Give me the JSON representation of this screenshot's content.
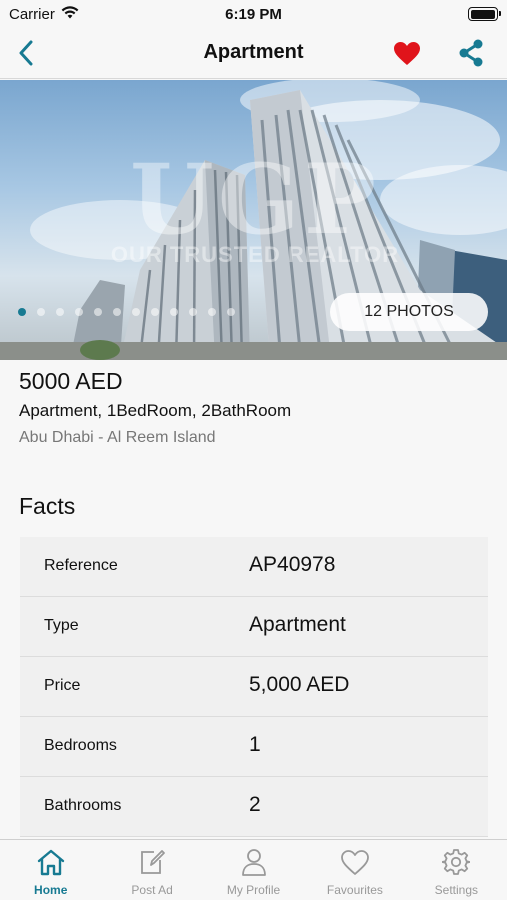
{
  "status_bar": {
    "carrier": "Carrier",
    "time": "6:19 PM",
    "battery_level": 1.0
  },
  "nav": {
    "title": "Apartment",
    "icons": [
      "back-chevron-icon",
      "heart-icon",
      "share-icon"
    ],
    "favourite_active": true
  },
  "gallery": {
    "photos_label": "12 PHOTOS",
    "watermark": {
      "mark": "UGP",
      "tagline": "OUR TRUSTED REALTOR"
    },
    "dot_count": 12,
    "active_index": 0
  },
  "listing": {
    "price": "5000 AED",
    "subtitle": "Apartment, 1BedRoom, 2BathRoom",
    "location": "Abu Dhabi - Al Reem Island"
  },
  "facts": {
    "title": "Facts",
    "rows": [
      {
        "label": "Reference",
        "value": "AP40978"
      },
      {
        "label": "Type",
        "value": "Apartment"
      },
      {
        "label": "Price",
        "value": "5,000 AED"
      },
      {
        "label": "Bedrooms",
        "value": "1"
      },
      {
        "label": "Bathrooms",
        "value": "2"
      }
    ]
  },
  "tabs": [
    {
      "label": "Home",
      "icon": "home-icon",
      "active": true
    },
    {
      "label": "Post Ad",
      "icon": "post-ad-icon",
      "active": false
    },
    {
      "label": "My Profile",
      "icon": "profile-icon",
      "active": false
    },
    {
      "label": "Favourites",
      "icon": "heart-outline-icon",
      "active": false
    },
    {
      "label": "Settings",
      "icon": "gear-icon",
      "active": false
    }
  ],
  "colors": {
    "accent": "#177a92",
    "favourite": "#e0141b",
    "inactive": "#999999"
  }
}
